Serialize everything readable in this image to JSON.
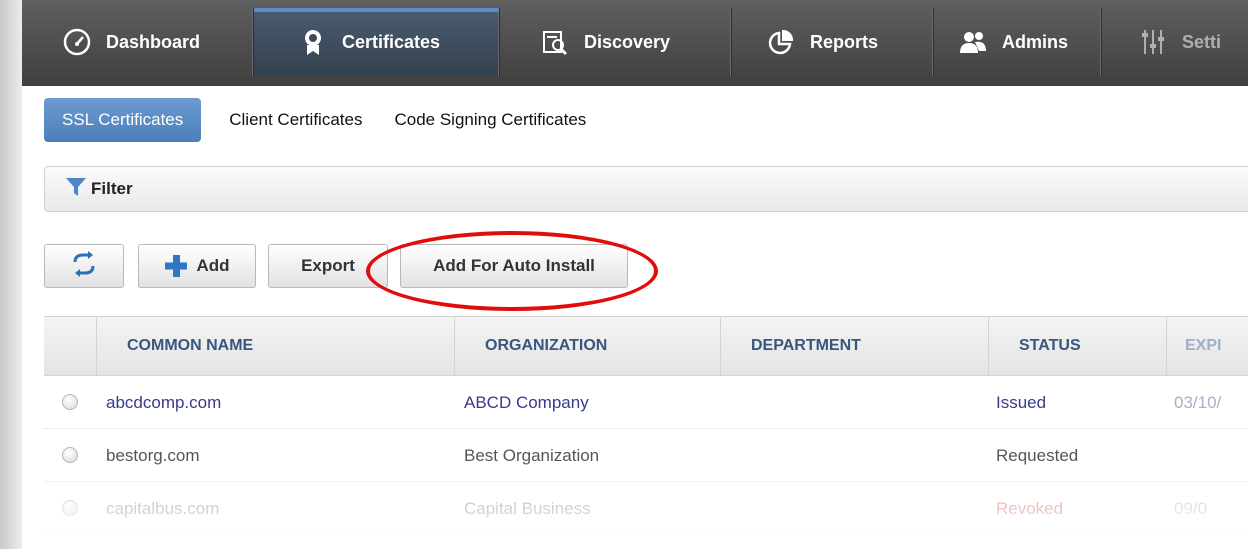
{
  "nav": {
    "tabs": [
      {
        "label": "Dashboard",
        "icon": "speedometer-icon"
      },
      {
        "label": "Certificates",
        "icon": "certificate-badge-icon"
      },
      {
        "label": "Discovery",
        "icon": "magnifier-document-icon"
      },
      {
        "label": "Reports",
        "icon": "pie-chart-icon"
      },
      {
        "label": "Admins",
        "icon": "users-icon"
      },
      {
        "label": "Setti",
        "icon": "sliders-icon"
      }
    ],
    "active": "Certificates"
  },
  "subtabs": [
    "SSL Certificates",
    "Client Certificates",
    "Code Signing Certificates"
  ],
  "filter": {
    "label": "Filter",
    "icon": "funnel-icon"
  },
  "toolbar": {
    "refresh_icon": "refresh-icon",
    "add_label": "Add",
    "add_icon": "plus-icon",
    "export_label": "Export",
    "auto_install_label": "Add For Auto Install"
  },
  "table": {
    "columns": [
      "COMMON NAME",
      "ORGANIZATION",
      "DEPARTMENT",
      "STATUS",
      "EXPI"
    ],
    "rows": [
      {
        "common_name": "abcdcomp.com",
        "organization": "ABCD Company",
        "department": "",
        "status": "Issued",
        "expires": "03/10/"
      },
      {
        "common_name": "bestorg.com",
        "organization": "Best Organization",
        "department": "",
        "status": "Requested",
        "expires": ""
      },
      {
        "common_name": "capitalbus.com",
        "organization": "Capital Business",
        "department": "",
        "status": "Revoked",
        "expires": "09/0"
      }
    ]
  },
  "colors": {
    "nav_bg": "#4a4a4a",
    "active_tab": "#3b4a5c",
    "subtab_active": "#5a8ac4",
    "header_text": "#38567e",
    "link_text": "#3a3a8c",
    "revoked": "#e06060",
    "highlight": "#e10d0d"
  }
}
